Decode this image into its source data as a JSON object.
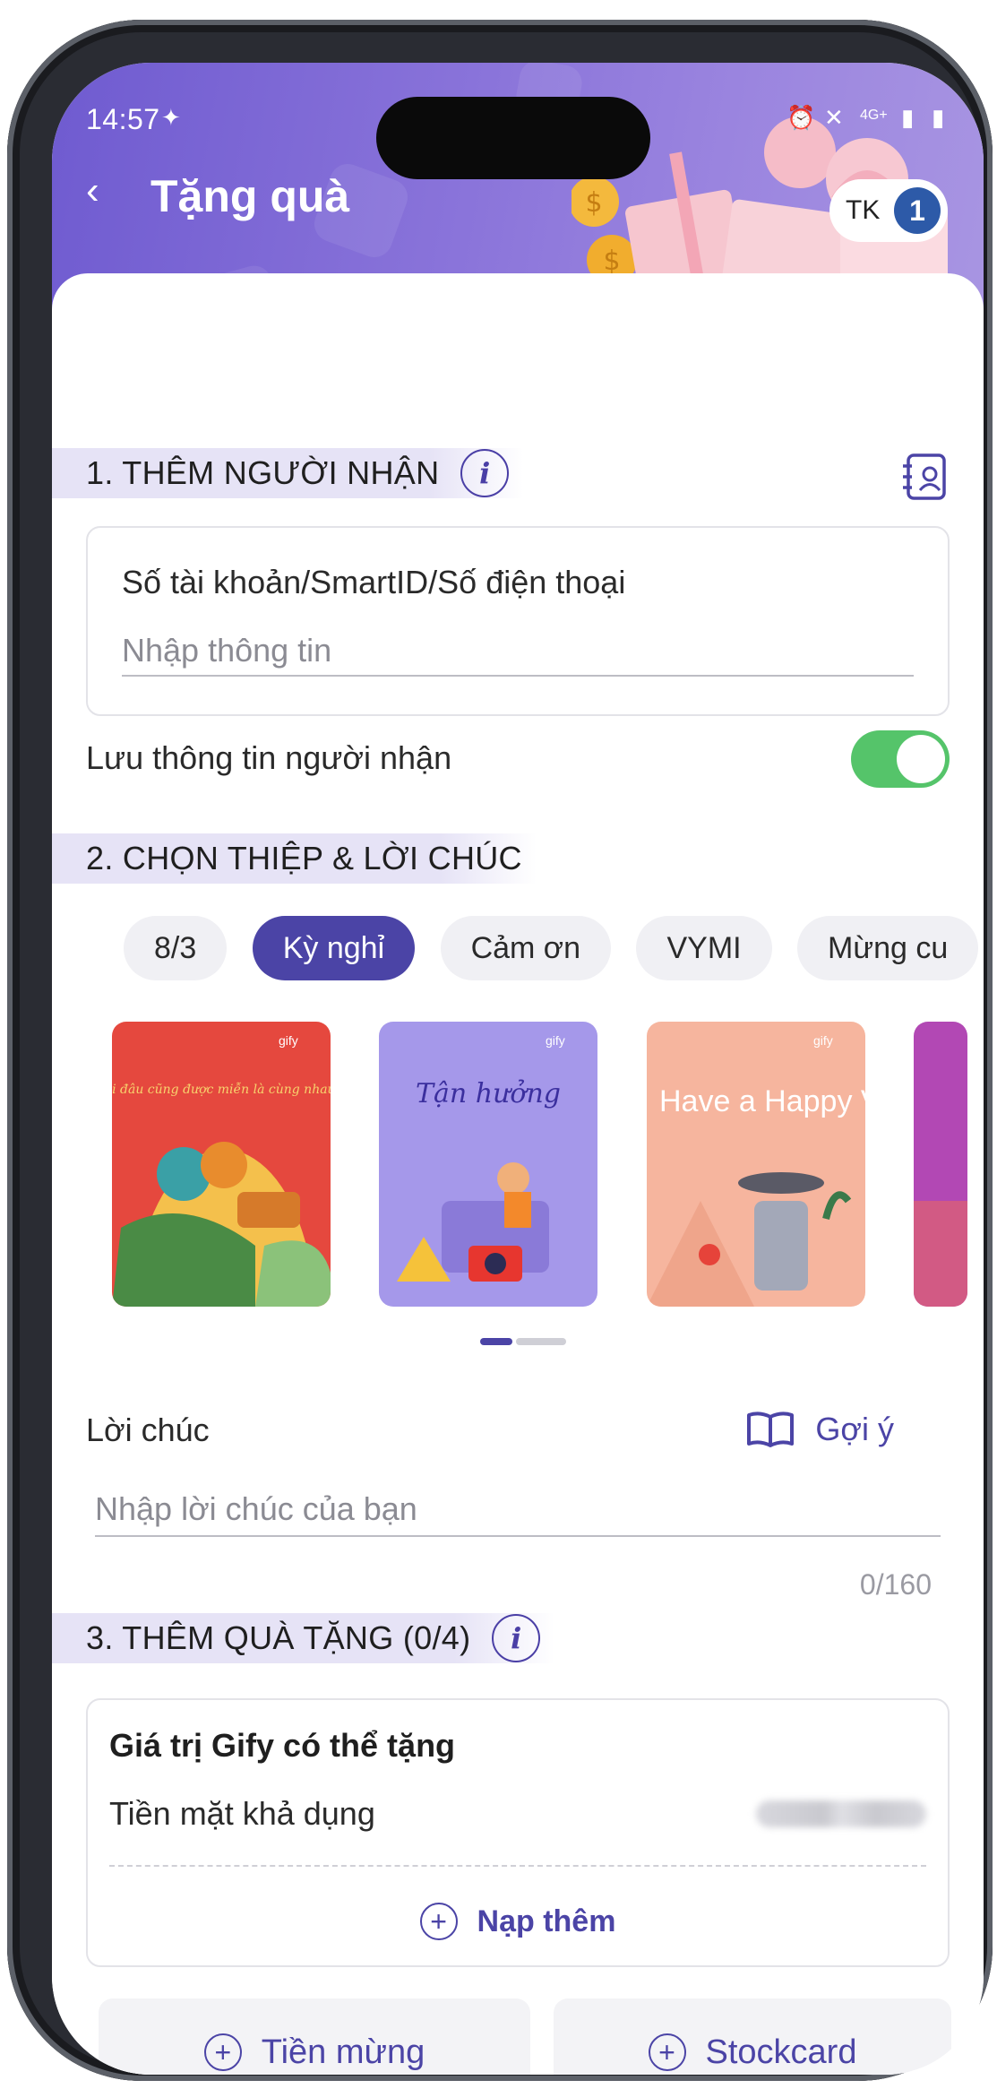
{
  "status_bar": {
    "time": "14:57",
    "network": "4G+"
  },
  "header": {
    "title": "Tặng quà",
    "account_label": "TK",
    "account_count": "1"
  },
  "section1": {
    "title": "1. THÊM NGƯỜI NHẬN",
    "field_label": "Số tài khoản/SmartID/Số điện thoại",
    "placeholder": "Nhập thông tin",
    "save_label": "Lưu thông tin người nhận",
    "save_enabled": true
  },
  "section2": {
    "title": "2. CHỌN THIỆP & LỜI CHÚC",
    "chips": [
      "8/3",
      "Kỳ nghỉ",
      "Cảm ơn",
      "VYMI",
      "Mừng cu"
    ],
    "selected_chip": "Kỳ nghỉ",
    "cards": [
      {
        "brand": "gify",
        "text": "Đi đâu cũng được miễn là cùng nhau!"
      },
      {
        "brand": "gify",
        "text": "Tận hưởng"
      },
      {
        "brand": "gify",
        "text": "Have a Happy Vacation!"
      }
    ],
    "message_label": "Lời chúc",
    "suggest_label": "Gợi ý",
    "message_placeholder": "Nhập lời chúc của bạn",
    "counter": "0/160"
  },
  "section3": {
    "title": "3. THÊM QUÀ TẶNG (0/4)",
    "card_title": "Giá trị Gify có thể tặng",
    "cash_label": "Tiền mặt khả dụng",
    "topup_label": "Nạp thêm",
    "buttons": [
      "Tiền mừng",
      "Stockcard"
    ]
  },
  "colors": {
    "accent": "#4b44a6",
    "toggle_on": "#55c46a",
    "header": "#7b66d4"
  }
}
